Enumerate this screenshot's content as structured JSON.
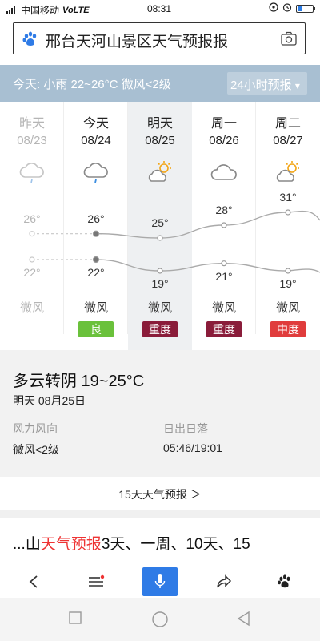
{
  "status_bar": {
    "signal": "4G",
    "carrier": "中国移动",
    "network": "VoLTE",
    "time": "08:31",
    "battery_level": 0.25
  },
  "search": {
    "query": "邢台天河山景区天气预报报",
    "left_icon": "paw-icon",
    "right_icon": "camera-icon"
  },
  "today": {
    "summary": "今天: 小雨  22~26°C  微风<2级",
    "hourly_label": "24小时预报",
    "hourly_chevron": "▾"
  },
  "forecast": {
    "days": [
      {
        "name": "昨天",
        "date": "08/23",
        "icon": "light-rain-icon",
        "high": "26°",
        "low": "22°",
        "wind": "微风",
        "aqi": "",
        "aqi_color": "",
        "past": true
      },
      {
        "name": "今天",
        "date": "08/24",
        "icon": "light-rain-icon",
        "high": "26°",
        "low": "22°",
        "wind": "微风",
        "aqi": "良",
        "aqi_color": "#6ac13b",
        "past": false
      },
      {
        "name": "明天",
        "date": "08/25",
        "icon": "partly-sunny-icon",
        "high": "25°",
        "low": "19°",
        "wind": "微风",
        "aqi": "重度",
        "aqi_color": "#8a1c3a",
        "past": false
      },
      {
        "name": "周一",
        "date": "08/26",
        "icon": "cloudy-icon",
        "high": "28°",
        "low": "21°",
        "wind": "微风",
        "aqi": "重度",
        "aqi_color": "#8a1c3a",
        "past": false
      },
      {
        "name": "周二",
        "date": "08/27",
        "icon": "partly-sunny-icon",
        "high": "31°",
        "low": "19°",
        "wind": "微风",
        "aqi": "中度",
        "aqi_color": "#e03c3c",
        "past": false
      }
    ],
    "high_temps": [
      26,
      26,
      25,
      28,
      31
    ],
    "low_temps": [
      22,
      22,
      19,
      21,
      19
    ]
  },
  "detail": {
    "condition": "多云转阴  19~25°C",
    "date": "明天  08月25日",
    "wind_label": "风力风向",
    "wind_value": "微风<2级",
    "sun_label": "日出日落",
    "sun_value": "05:46/19:01"
  },
  "more_link": "15天天气预报 ＞",
  "result": {
    "prefix": "...山",
    "highlight": "天气预报",
    "suffix": "3天、一周、10天、15"
  },
  "bottom_nav": {
    "back": "back-icon",
    "menu": "menu-icon",
    "mic": "microphone-icon",
    "share": "share-icon",
    "home": "paw-icon"
  },
  "colors": {
    "accent": "#2f7be6",
    "today_bar": "#a8bfd2",
    "highlight": "#e33333"
  }
}
